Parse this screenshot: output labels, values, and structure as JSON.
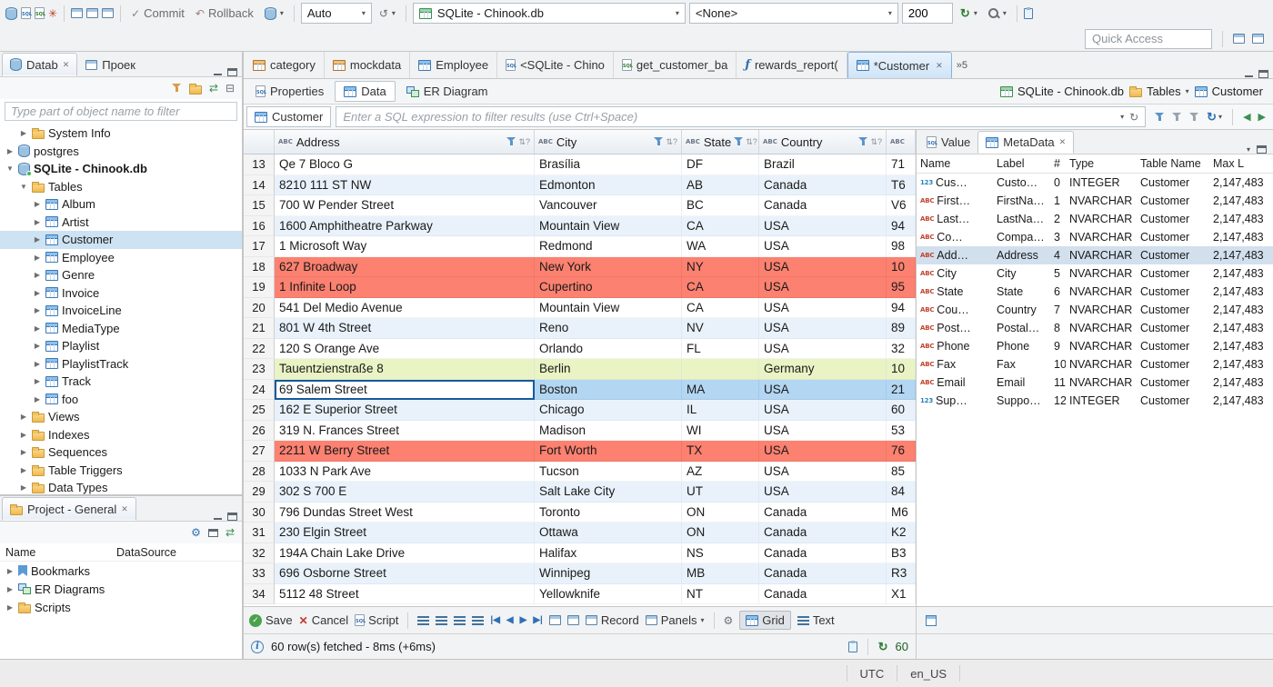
{
  "topbar": {
    "commit": "Commit",
    "rollback": "Rollback",
    "autocommit": "Auto",
    "datasource": "SQLite - Chinook.db",
    "schema": "<None>",
    "fetch_size": "200",
    "quick_access_placeholder": "Quick Access"
  },
  "navigator": {
    "tabs": [
      {
        "label": "Datab"
      },
      {
        "label": "Проек"
      }
    ],
    "filter_placeholder": "Type part of object name to filter",
    "tree": [
      {
        "label": "System Info",
        "depth": 1,
        "icon": "folder",
        "arrow": "right"
      },
      {
        "label": "postgres",
        "depth": 0,
        "icon": "db",
        "arrow": "right"
      },
      {
        "label": "SQLite - Chinook.db",
        "depth": 0,
        "icon": "db",
        "arrow": "down",
        "connected": true,
        "bold": true
      },
      {
        "label": "Tables",
        "depth": 1,
        "icon": "folder",
        "arrow": "down"
      },
      {
        "label": "Album",
        "depth": 2,
        "icon": "table",
        "arrow": "right"
      },
      {
        "label": "Artist",
        "depth": 2,
        "icon": "table",
        "arrow": "right"
      },
      {
        "label": "Customer",
        "depth": 2,
        "icon": "table",
        "arrow": "right",
        "selected": true
      },
      {
        "label": "Employee",
        "depth": 2,
        "icon": "table",
        "arrow": "right"
      },
      {
        "label": "Genre",
        "depth": 2,
        "icon": "table",
        "arrow": "right"
      },
      {
        "label": "Invoice",
        "depth": 2,
        "icon": "table",
        "arrow": "right"
      },
      {
        "label": "InvoiceLine",
        "depth": 2,
        "icon": "table",
        "arrow": "right"
      },
      {
        "label": "MediaType",
        "depth": 2,
        "icon": "table",
        "arrow": "right"
      },
      {
        "label": "Playlist",
        "depth": 2,
        "icon": "table",
        "arrow": "right"
      },
      {
        "label": "PlaylistTrack",
        "depth": 2,
        "icon": "table",
        "arrow": "right"
      },
      {
        "label": "Track",
        "depth": 2,
        "icon": "table",
        "arrow": "right"
      },
      {
        "label": "foo",
        "depth": 2,
        "icon": "table",
        "arrow": "right"
      },
      {
        "label": "Views",
        "depth": 1,
        "icon": "folder",
        "arrow": "right"
      },
      {
        "label": "Indexes",
        "depth": 1,
        "icon": "folder",
        "arrow": "right"
      },
      {
        "label": "Sequences",
        "depth": 1,
        "icon": "folder",
        "arrow": "right"
      },
      {
        "label": "Table Triggers",
        "depth": 1,
        "icon": "folder",
        "arrow": "right"
      },
      {
        "label": "Data Types",
        "depth": 1,
        "icon": "folder",
        "arrow": "right"
      }
    ]
  },
  "project_panel": {
    "title": "Project - General",
    "name_column": "Name",
    "datasource_column": "DataSource",
    "items": [
      {
        "label": "Bookmarks",
        "icon": "bookmark"
      },
      {
        "label": "ER Diagrams",
        "icon": "diagram"
      },
      {
        "label": "Scripts",
        "icon": "folder"
      }
    ]
  },
  "editor": {
    "tabs": [
      {
        "label": "category",
        "icon": "table-orange"
      },
      {
        "label": "mockdata",
        "icon": "table-orange"
      },
      {
        "label": "Employee",
        "icon": "table"
      },
      {
        "label": "<SQLite - Chino",
        "icon": "sql"
      },
      {
        "label": "get_customer_ba",
        "icon": "sql-green"
      },
      {
        "label": "rewards_report(",
        "icon": "func"
      },
      {
        "label": "*Customer",
        "icon": "table",
        "active": true
      }
    ],
    "overflow_count": "»5",
    "subtabs": [
      {
        "label": "Properties"
      },
      {
        "label": "Data",
        "active": true
      },
      {
        "label": "ER Diagram"
      }
    ],
    "breadcrumb": [
      {
        "label": "SQLite - Chinook.db"
      },
      {
        "label": "Tables"
      },
      {
        "label": "Customer"
      }
    ],
    "filter_entity": "Customer",
    "filter_placeholder": "Enter a SQL expression to filter results (use Ctrl+Space)"
  },
  "grid": {
    "columns": [
      "Address",
      "City",
      "State",
      "Country"
    ],
    "rows": [
      {
        "n": "13",
        "address": "Qe 7 Bloco G",
        "city": "Brasília",
        "state": "DF",
        "country": "Brazil",
        "postal": "71",
        "bg": "plain"
      },
      {
        "n": "14",
        "address": "8210 111 ST NW",
        "city": "Edmonton",
        "state": "AB",
        "country": "Canada",
        "postal": "T6",
        "bg": "stripe"
      },
      {
        "n": "15",
        "address": "700 W Pender Street",
        "city": "Vancouver",
        "state": "BC",
        "country": "Canada",
        "postal": "V6",
        "bg": "plain"
      },
      {
        "n": "16",
        "address": "1600 Amphitheatre Parkway",
        "city": "Mountain View",
        "state": "CA",
        "country": "USA",
        "postal": "94",
        "bg": "stripe"
      },
      {
        "n": "17",
        "address": "1 Microsoft Way",
        "city": "Redmond",
        "state": "WA",
        "country": "USA",
        "postal": "98",
        "bg": "plain"
      },
      {
        "n": "18",
        "address": "627 Broadway",
        "city": "New York",
        "state": "NY",
        "country": "USA",
        "postal": "10",
        "bg": "red"
      },
      {
        "n": "19",
        "address": "1 Infinite Loop",
        "city": "Cupertino",
        "state": "CA",
        "country": "USA",
        "postal": "95",
        "bg": "red"
      },
      {
        "n": "20",
        "address": "541 Del Medio Avenue",
        "city": "Mountain View",
        "state": "CA",
        "country": "USA",
        "postal": "94",
        "bg": "plain"
      },
      {
        "n": "21",
        "address": "801 W 4th Street",
        "city": "Reno",
        "state": "NV",
        "country": "USA",
        "postal": "89",
        "bg": "stripe"
      },
      {
        "n": "22",
        "address": "120 S Orange Ave",
        "city": "Orlando",
        "state": "FL",
        "country": "USA",
        "postal": "32",
        "bg": "plain"
      },
      {
        "n": "23",
        "address": "Tauentzienstraße 8",
        "city": "Berlin",
        "state": "",
        "country": "Germany",
        "postal": "10",
        "bg": "green"
      },
      {
        "n": "24",
        "address": "69 Salem Street",
        "city": "Boston",
        "state": "MA",
        "country": "USA",
        "postal": "21",
        "bg": "selected",
        "focus": "address"
      },
      {
        "n": "25",
        "address": "162 E Superior Street",
        "city": "Chicago",
        "state": "IL",
        "country": "USA",
        "postal": "60",
        "bg": "stripe"
      },
      {
        "n": "26",
        "address": "319 N. Frances Street",
        "city": "Madison",
        "state": "WI",
        "country": "USA",
        "postal": "53",
        "bg": "plain"
      },
      {
        "n": "27",
        "address": "2211 W Berry Street",
        "city": "Fort Worth",
        "state": "TX",
        "country": "USA",
        "postal": "76",
        "bg": "red"
      },
      {
        "n": "28",
        "address": "1033 N Park Ave",
        "city": "Tucson",
        "state": "AZ",
        "country": "USA",
        "postal": "85",
        "bg": "plain"
      },
      {
        "n": "29",
        "address": "302 S 700 E",
        "city": "Salt Lake City",
        "state": "UT",
        "country": "USA",
        "postal": "84",
        "bg": "stripe"
      },
      {
        "n": "30",
        "address": "796 Dundas Street West",
        "city": "Toronto",
        "state": "ON",
        "country": "Canada",
        "postal": "M6",
        "bg": "plain"
      },
      {
        "n": "31",
        "address": "230 Elgin Street",
        "city": "Ottawa",
        "state": "ON",
        "country": "Canada",
        "postal": "K2",
        "bg": "stripe"
      },
      {
        "n": "32",
        "address": "194A Chain Lake Drive",
        "city": "Halifax",
        "state": "NS",
        "country": "Canada",
        "postal": "B3",
        "bg": "plain"
      },
      {
        "n": "33",
        "address": "696 Osborne Street",
        "city": "Winnipeg",
        "state": "MB",
        "country": "Canada",
        "postal": "R3",
        "bg": "stripe"
      },
      {
        "n": "34",
        "address": "5112 48 Street",
        "city": "Yellowknife",
        "state": "NT",
        "country": "Canada",
        "postal": "X1",
        "bg": "plain"
      }
    ]
  },
  "meta": {
    "tabs": [
      {
        "label": "Value"
      },
      {
        "label": "MetaData",
        "active": true
      }
    ],
    "columns": [
      "Name",
      "Label",
      "#",
      "Type",
      "Table Name",
      "Max L"
    ],
    "rows": [
      {
        "icon": "123",
        "name": "Cus…",
        "label": "Custo…",
        "num": "0",
        "type": "INTEGER",
        "table": "Customer",
        "maxlen": "2,147,483"
      },
      {
        "icon": "abc",
        "name": "First…",
        "label": "FirstNa…",
        "num": "1",
        "type": "NVARCHAR",
        "table": "Customer",
        "maxlen": "2,147,483"
      },
      {
        "icon": "abc",
        "name": "Last…",
        "label": "LastNa…",
        "num": "2",
        "type": "NVARCHAR",
        "table": "Customer",
        "maxlen": "2,147,483"
      },
      {
        "icon": "abc",
        "name": "Co…",
        "label": "Compa…",
        "num": "3",
        "type": "NVARCHAR",
        "table": "Customer",
        "maxlen": "2,147,483"
      },
      {
        "icon": "abc",
        "name": "Add…",
        "label": "Address",
        "num": "4",
        "type": "NVARCHAR",
        "table": "Customer",
        "maxlen": "2,147,483",
        "selected": true
      },
      {
        "icon": "abc",
        "name": "City",
        "label": "City",
        "num": "5",
        "type": "NVARCHAR",
        "table": "Customer",
        "maxlen": "2,147,483"
      },
      {
        "icon": "abc",
        "name": "State",
        "label": "State",
        "num": "6",
        "type": "NVARCHAR",
        "table": "Customer",
        "maxlen": "2,147,483"
      },
      {
        "icon": "abc",
        "name": "Cou…",
        "label": "Country",
        "num": "7",
        "type": "NVARCHAR",
        "table": "Customer",
        "maxlen": "2,147,483"
      },
      {
        "icon": "abc",
        "name": "Post…",
        "label": "Postal…",
        "num": "8",
        "type": "NVARCHAR",
        "table": "Customer",
        "maxlen": "2,147,483"
      },
      {
        "icon": "abc",
        "name": "Phone",
        "label": "Phone",
        "num": "9",
        "type": "NVARCHAR",
        "table": "Customer",
        "maxlen": "2,147,483"
      },
      {
        "icon": "abc",
        "name": "Fax",
        "label": "Fax",
        "num": "10",
        "type": "NVARCHAR",
        "table": "Customer",
        "maxlen": "2,147,483"
      },
      {
        "icon": "abc",
        "name": "Email",
        "label": "Email",
        "num": "11",
        "type": "NVARCHAR",
        "table": "Customer",
        "maxlen": "2,147,483"
      },
      {
        "icon": "123",
        "name": "Sup…",
        "label": "Suppo…",
        "num": "12",
        "type": "INTEGER",
        "table": "Customer",
        "maxlen": "2,147,483"
      }
    ]
  },
  "result_toolbar": {
    "save": "Save",
    "cancel": "Cancel",
    "script": "Script",
    "record": "Record",
    "panels": "Panels",
    "grid": "Grid",
    "text": "Text"
  },
  "status": {
    "message": "60 row(s) fetched - 8ms (+6ms)",
    "refresh_count": "60"
  },
  "os_bar": {
    "timezone": "UTC",
    "locale": "en_US"
  },
  "colors": {
    "row_red": "#fc8170",
    "row_green": "#e9f3c4",
    "row_selected": "#b3d6f2",
    "row_stripe": "#e9f2fb",
    "accent_blue": "#2f6fb2",
    "tab_active": "#cfe4f7"
  }
}
